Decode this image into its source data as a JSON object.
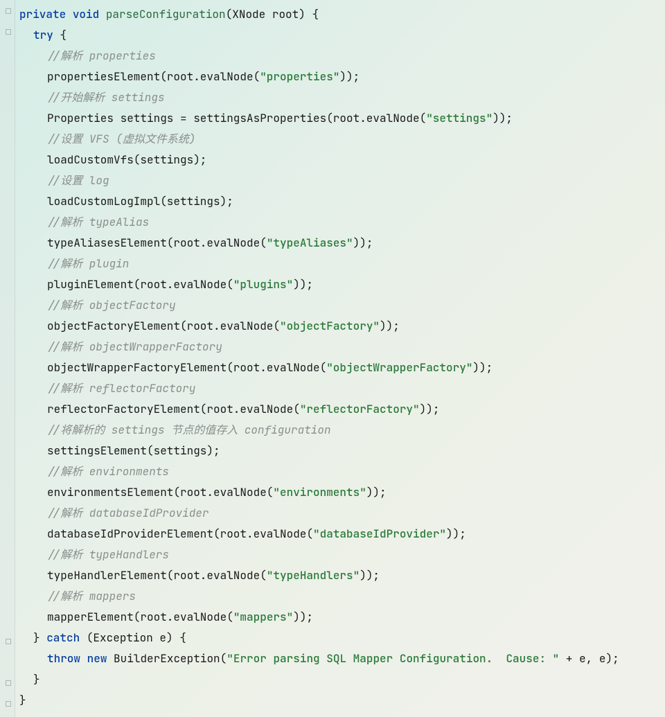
{
  "code": {
    "lines": [
      {
        "indent": "i1",
        "tokens": [
          {
            "cls": "k",
            "t": "private"
          },
          {
            "cls": "p",
            "t": " "
          },
          {
            "cls": "k",
            "t": "void"
          },
          {
            "cls": "p",
            "t": " "
          },
          {
            "cls": "m",
            "t": "parseConfiguration"
          },
          {
            "cls": "p",
            "t": "(XNode root) {"
          }
        ]
      },
      {
        "indent": "i2",
        "tokens": [
          {
            "cls": "k",
            "t": "try"
          },
          {
            "cls": "p",
            "t": " {"
          }
        ]
      },
      {
        "indent": "i3",
        "tokens": [
          {
            "cls": "c",
            "t": "//解析 properties"
          }
        ]
      },
      {
        "indent": "i3",
        "tokens": [
          {
            "cls": "p",
            "t": "propertiesElement(root.evalNode("
          },
          {
            "cls": "s",
            "t": "\"properties\""
          },
          {
            "cls": "p",
            "t": "));"
          }
        ]
      },
      {
        "indent": "i3",
        "tokens": [
          {
            "cls": "c",
            "t": "//开始解析 settings"
          }
        ]
      },
      {
        "indent": "i3",
        "tokens": [
          {
            "cls": "p",
            "t": "Properties settings = settingsAsProperties(root.evalNode("
          },
          {
            "cls": "s",
            "t": "\"settings\""
          },
          {
            "cls": "p",
            "t": "));"
          }
        ]
      },
      {
        "indent": "i3",
        "tokens": [
          {
            "cls": "c",
            "t": "//设置 VFS (虚拟文件系统)"
          }
        ]
      },
      {
        "indent": "i3",
        "tokens": [
          {
            "cls": "p",
            "t": "loadCustomVfs(settings);"
          }
        ]
      },
      {
        "indent": "i3",
        "tokens": [
          {
            "cls": "c",
            "t": "//设置 log"
          }
        ]
      },
      {
        "indent": "i3",
        "tokens": [
          {
            "cls": "p",
            "t": "loadCustomLogImpl(settings);"
          }
        ]
      },
      {
        "indent": "i3",
        "tokens": [
          {
            "cls": "c",
            "t": "//解析 typeAlias"
          }
        ]
      },
      {
        "indent": "i3",
        "tokens": [
          {
            "cls": "p",
            "t": "typeAliasesElement(root.evalNode("
          },
          {
            "cls": "s",
            "t": "\"typeAliases\""
          },
          {
            "cls": "p",
            "t": "));"
          }
        ]
      },
      {
        "indent": "i3",
        "tokens": [
          {
            "cls": "c",
            "t": "//解析 plugin"
          }
        ]
      },
      {
        "indent": "i3",
        "tokens": [
          {
            "cls": "p",
            "t": "pluginElement(root.evalNode("
          },
          {
            "cls": "s",
            "t": "\"plugins\""
          },
          {
            "cls": "p",
            "t": "));"
          }
        ]
      },
      {
        "indent": "i3",
        "tokens": [
          {
            "cls": "c",
            "t": "//解析 objectFactory"
          }
        ]
      },
      {
        "indent": "i3",
        "tokens": [
          {
            "cls": "p",
            "t": "objectFactoryElement(root.evalNode("
          },
          {
            "cls": "s",
            "t": "\"objectFactory\""
          },
          {
            "cls": "p",
            "t": "));"
          }
        ]
      },
      {
        "indent": "i3",
        "tokens": [
          {
            "cls": "c",
            "t": "//解析 objectWrapperFactory"
          }
        ]
      },
      {
        "indent": "i3",
        "tokens": [
          {
            "cls": "p",
            "t": "objectWrapperFactoryElement(root.evalNode("
          },
          {
            "cls": "s",
            "t": "\"objectWrapperFactory\""
          },
          {
            "cls": "p",
            "t": "));"
          }
        ]
      },
      {
        "indent": "i3",
        "tokens": [
          {
            "cls": "c",
            "t": "//解析 reflectorFactory"
          }
        ]
      },
      {
        "indent": "i3",
        "tokens": [
          {
            "cls": "p",
            "t": "reflectorFactoryElement(root.evalNode("
          },
          {
            "cls": "s",
            "t": "\"reflectorFactory\""
          },
          {
            "cls": "p",
            "t": "));"
          }
        ]
      },
      {
        "indent": "i3",
        "tokens": [
          {
            "cls": "c",
            "t": "//将解析的 settings 节点的值存入 configuration"
          }
        ]
      },
      {
        "indent": "i3",
        "tokens": [
          {
            "cls": "p",
            "t": "settingsElement(settings);"
          }
        ]
      },
      {
        "indent": "i3",
        "tokens": [
          {
            "cls": "c",
            "t": "//解析 environments"
          }
        ]
      },
      {
        "indent": "i3",
        "tokens": [
          {
            "cls": "p",
            "t": "environmentsElement(root.evalNode("
          },
          {
            "cls": "s",
            "t": "\"environments\""
          },
          {
            "cls": "p",
            "t": "));"
          }
        ]
      },
      {
        "indent": "i3",
        "tokens": [
          {
            "cls": "c",
            "t": "//解析 databaseIdProvider"
          }
        ]
      },
      {
        "indent": "i3",
        "tokens": [
          {
            "cls": "p",
            "t": "databaseIdProviderElement(root.evalNode("
          },
          {
            "cls": "s",
            "t": "\"databaseIdProvider\""
          },
          {
            "cls": "p",
            "t": "));"
          }
        ]
      },
      {
        "indent": "i3",
        "tokens": [
          {
            "cls": "c",
            "t": "//解析 typeHandlers"
          }
        ]
      },
      {
        "indent": "i3",
        "tokens": [
          {
            "cls": "p",
            "t": "typeHandlerElement(root.evalNode("
          },
          {
            "cls": "s",
            "t": "\"typeHandlers\""
          },
          {
            "cls": "p",
            "t": "));"
          }
        ]
      },
      {
        "indent": "i3",
        "tokens": [
          {
            "cls": "c",
            "t": "//解析 mappers"
          }
        ]
      },
      {
        "indent": "i3",
        "tokens": [
          {
            "cls": "p",
            "t": "mapperElement(root.evalNode("
          },
          {
            "cls": "s",
            "t": "\"mappers\""
          },
          {
            "cls": "p",
            "t": "));"
          }
        ]
      },
      {
        "indent": "i2",
        "tokens": [
          {
            "cls": "p",
            "t": "} "
          },
          {
            "cls": "k",
            "t": "catch"
          },
          {
            "cls": "p",
            "t": " (Exception e) {"
          }
        ]
      },
      {
        "indent": "i3",
        "tokens": [
          {
            "cls": "k",
            "t": "throw"
          },
          {
            "cls": "p",
            "t": " "
          },
          {
            "cls": "k",
            "t": "new"
          },
          {
            "cls": "p",
            "t": " BuilderException("
          },
          {
            "cls": "s",
            "t": "\"Error parsing SQL Mapper Configuration.  Cause: \""
          },
          {
            "cls": "p",
            "t": " + e, e);"
          }
        ]
      },
      {
        "indent": "i2",
        "tokens": [
          {
            "cls": "p",
            "t": "}"
          }
        ]
      },
      {
        "indent": "i1",
        "tokens": [
          {
            "cls": "p",
            "t": "}"
          }
        ]
      }
    ]
  },
  "fold_markers": [
    6,
    36,
    916,
    976,
    1006
  ]
}
